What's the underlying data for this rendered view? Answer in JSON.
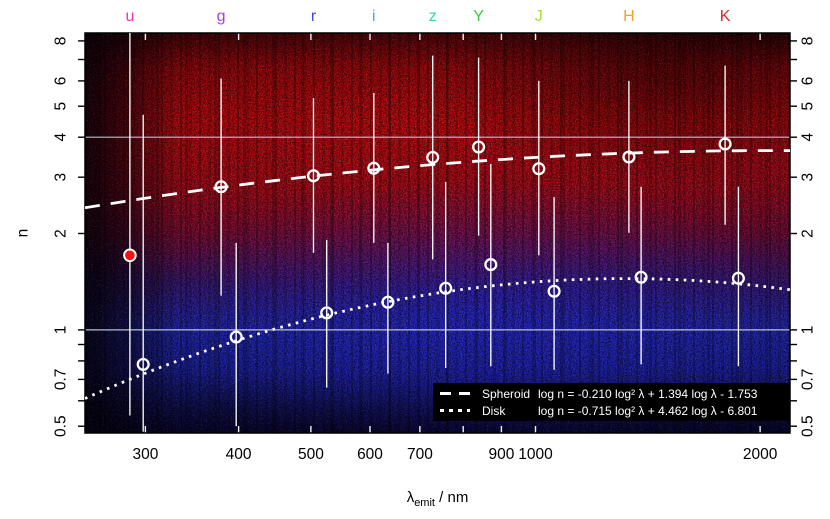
{
  "axes": {
    "x_title_lambda": "λ",
    "x_title_sub": "emit",
    "x_title_rest": " / nm",
    "y_title": "n",
    "x_ticks_labeled": [
      300,
      400,
      500,
      600,
      700,
      900,
      1000,
      2000
    ],
    "x_ticks_unlabeled": [
      800
    ],
    "y_ticks_labeled": [
      0.5,
      0.7,
      1,
      2,
      3,
      4,
      5,
      6,
      8
    ],
    "y_ticks_unlabeled": [
      0.6,
      0.8,
      0.9,
      7
    ],
    "gridlines_n": [
      1,
      4
    ]
  },
  "bands": [
    {
      "label": "u",
      "lambda_nm": 286,
      "color": "#ee2fc8"
    },
    {
      "label": "g",
      "lambda_nm": 379,
      "color": "#a93ce8"
    },
    {
      "label": "r",
      "lambda_nm": 504,
      "color": "#3a4ae0"
    },
    {
      "label": "i",
      "lambda_nm": 607,
      "color": "#35a8e8"
    },
    {
      "label": "z",
      "lambda_nm": 728,
      "color": "#2fd8a8"
    },
    {
      "label": "Y",
      "lambda_nm": 839,
      "color": "#3cc83c"
    },
    {
      "label": "J",
      "lambda_nm": 1010,
      "color": "#a6e02c"
    },
    {
      "label": "H",
      "lambda_nm": 1334,
      "color": "#f0a428"
    },
    {
      "label": "K",
      "lambda_nm": 1795,
      "color": "#e02626"
    }
  ],
  "chart_data": {
    "type": "scatter",
    "x_scale": "log",
    "y_scale": "log",
    "xlabel": "λemit / nm",
    "ylabel": "n",
    "xlim": [
      249,
      2193
    ],
    "ylim": [
      0.476,
      8.47
    ],
    "grid_n": [
      1,
      4
    ],
    "legend_position": "bottom-right",
    "series": [
      {
        "name": "Spheroid",
        "style": "dashed",
        "marker": "open-circle",
        "points": [
          {
            "band": "g",
            "lambda_nm": 379,
            "n": 2.8,
            "n_lo": 1.28,
            "n_hi": 6.1
          },
          {
            "band": "r",
            "lambda_nm": 504,
            "n": 3.03,
            "n_lo": 1.74,
            "n_hi": 5.3
          },
          {
            "band": "i",
            "lambda_nm": 607,
            "n": 3.2,
            "n_lo": 1.87,
            "n_hi": 5.5
          },
          {
            "band": "z",
            "lambda_nm": 728,
            "n": 3.46,
            "n_lo": 1.66,
            "n_hi": 7.2
          },
          {
            "band": "Y",
            "lambda_nm": 839,
            "n": 3.73,
            "n_lo": 1.97,
            "n_hi": 7.1
          },
          {
            "band": "J",
            "lambda_nm": 1010,
            "n": 3.19,
            "n_lo": 1.71,
            "n_hi": 6.0
          },
          {
            "band": "H",
            "lambda_nm": 1334,
            "n": 3.47,
            "n_lo": 2.01,
            "n_hi": 6.0
          },
          {
            "band": "K",
            "lambda_nm": 1795,
            "n": 3.81,
            "n_lo": 2.13,
            "n_hi": 6.7
          }
        ],
        "outlier": {
          "band": "u",
          "lambda_nm": 286,
          "n": 1.71,
          "n_lo": 0.54,
          "n_hi": 8.47,
          "marker": "filled-red-circle",
          "color": "#ee1414"
        },
        "fit": {
          "a": -0.21,
          "b": 1.394,
          "c": -1.753
        }
      },
      {
        "name": "Disk",
        "style": "dotted",
        "marker": "open-circle",
        "points": [
          {
            "band": "u",
            "lambda_nm": 298,
            "n": 0.78,
            "n_lo": 0.48,
            "n_hi": 4.7
          },
          {
            "band": "g",
            "lambda_nm": 397,
            "n": 0.95,
            "n_lo": 0.5,
            "n_hi": 1.87
          },
          {
            "band": "r",
            "lambda_nm": 525,
            "n": 1.13,
            "n_lo": 0.66,
            "n_hi": 1.91
          },
          {
            "band": "i",
            "lambda_nm": 634,
            "n": 1.22,
            "n_lo": 0.73,
            "n_hi": 1.87
          },
          {
            "band": "z",
            "lambda_nm": 758,
            "n": 1.35,
            "n_lo": 0.76,
            "n_hi": 2.9
          },
          {
            "band": "Y",
            "lambda_nm": 871,
            "n": 1.6,
            "n_lo": 0.77,
            "n_hi": 3.3
          },
          {
            "band": "J",
            "lambda_nm": 1059,
            "n": 1.32,
            "n_lo": 0.75,
            "n_hi": 2.6
          },
          {
            "band": "H",
            "lambda_nm": 1385,
            "n": 1.46,
            "n_lo": 0.78,
            "n_hi": 2.8
          },
          {
            "band": "K",
            "lambda_nm": 1870,
            "n": 1.45,
            "n_lo": 0.77,
            "n_hi": 2.8
          }
        ],
        "fit": {
          "a": -0.715,
          "b": 4.462,
          "c": -6.801
        }
      }
    ]
  },
  "legend": {
    "entries": [
      {
        "name": "Spheroid",
        "formula": "log n = -0.210 log² λ + 1.394 log λ - 1.753"
      },
      {
        "name": "Disk",
        "formula": "log n = -0.715 log² λ + 4.462 log λ - 6.801"
      }
    ]
  }
}
